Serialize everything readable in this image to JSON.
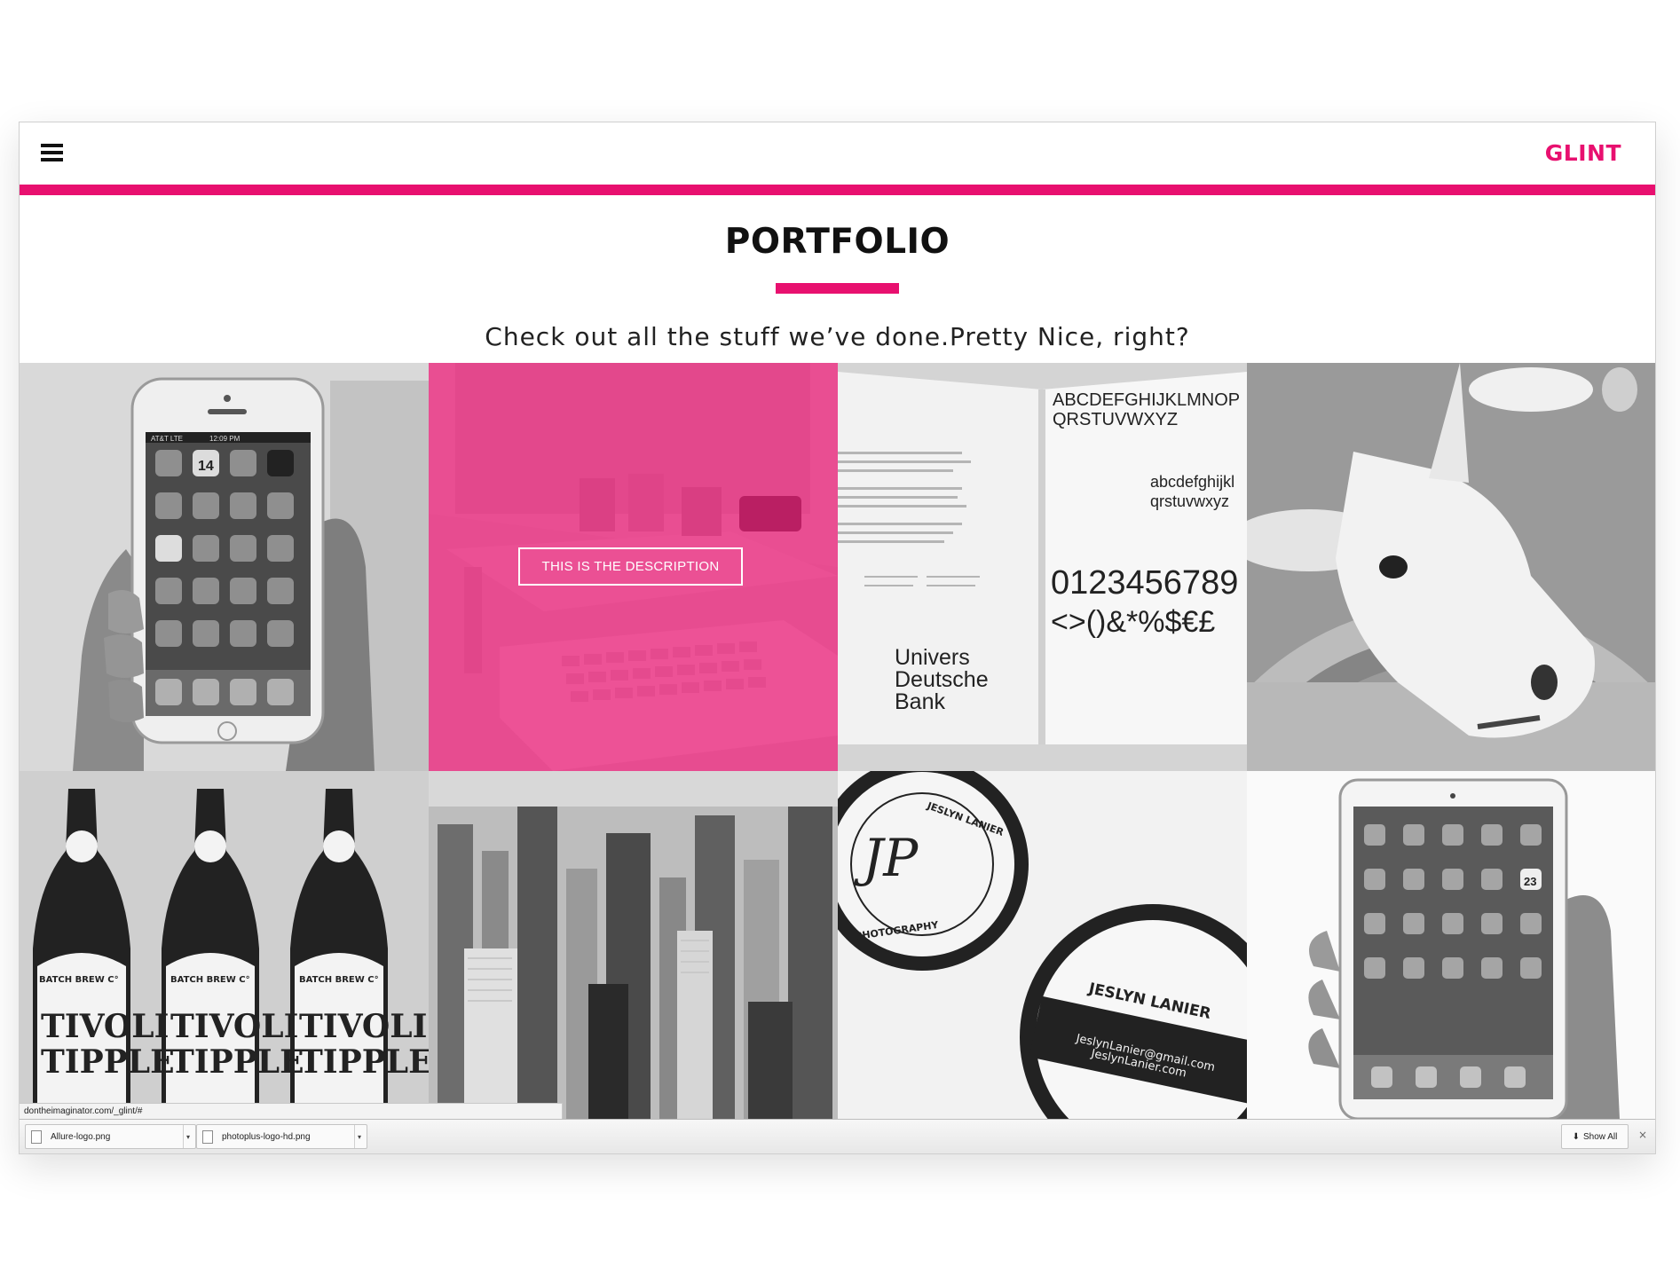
{
  "site": {
    "brand": "GLINT",
    "accent_color": "#e8106f",
    "menu_icon": "hamburger-icon"
  },
  "portfolio": {
    "title": "PORTFOLIO",
    "subtitle": "Check out all the stuff we’ve done.Pretty Nice, right?",
    "hover_description": "THIS IS THE DESCRIPTION",
    "items": [
      {
        "name": "iphone-photo",
        "image_text": [
          "AT&T LTE",
          "12:09 PM",
          "14"
        ]
      },
      {
        "name": "workspace-photo",
        "image_text": []
      },
      {
        "name": "typography-book-photo",
        "image_text": [
          "ABCDEFGHIJKLMNOP",
          "QRSTUVWXYZ",
          "abcdefghijkl",
          "qrstuvwxyz",
          "0123456789",
          "<>()&*%$€£",
          "Univers",
          "Deutsche",
          "Bank"
        ]
      },
      {
        "name": "unicorn-photo",
        "image_text": []
      },
      {
        "name": "beer-bottles-photo",
        "image_text": [
          "BATCH BREW C°",
          "TIVOLI",
          "TIPPLE"
        ]
      },
      {
        "name": "city-skyline-photo",
        "image_text": []
      },
      {
        "name": "business-cards-photo",
        "image_text": [
          "JESLYN LANIER",
          "PHOTOGRAPHY",
          "JeslynLanier@gmail.com",
          "JeslynLanier.com"
        ]
      },
      {
        "name": "ipad-photo",
        "image_text": [
          "23"
        ]
      }
    ]
  },
  "browser": {
    "status_url": "dontheimaginator.com/_glint/#",
    "downloads": [
      {
        "filename": "Allure-logo.png"
      },
      {
        "filename": "photoplus-logo-hd.png"
      }
    ],
    "show_all_label": "Show All",
    "show_all_icon": "download-arrow-icon",
    "close_icon": "close-icon",
    "close_glyph": "×"
  }
}
